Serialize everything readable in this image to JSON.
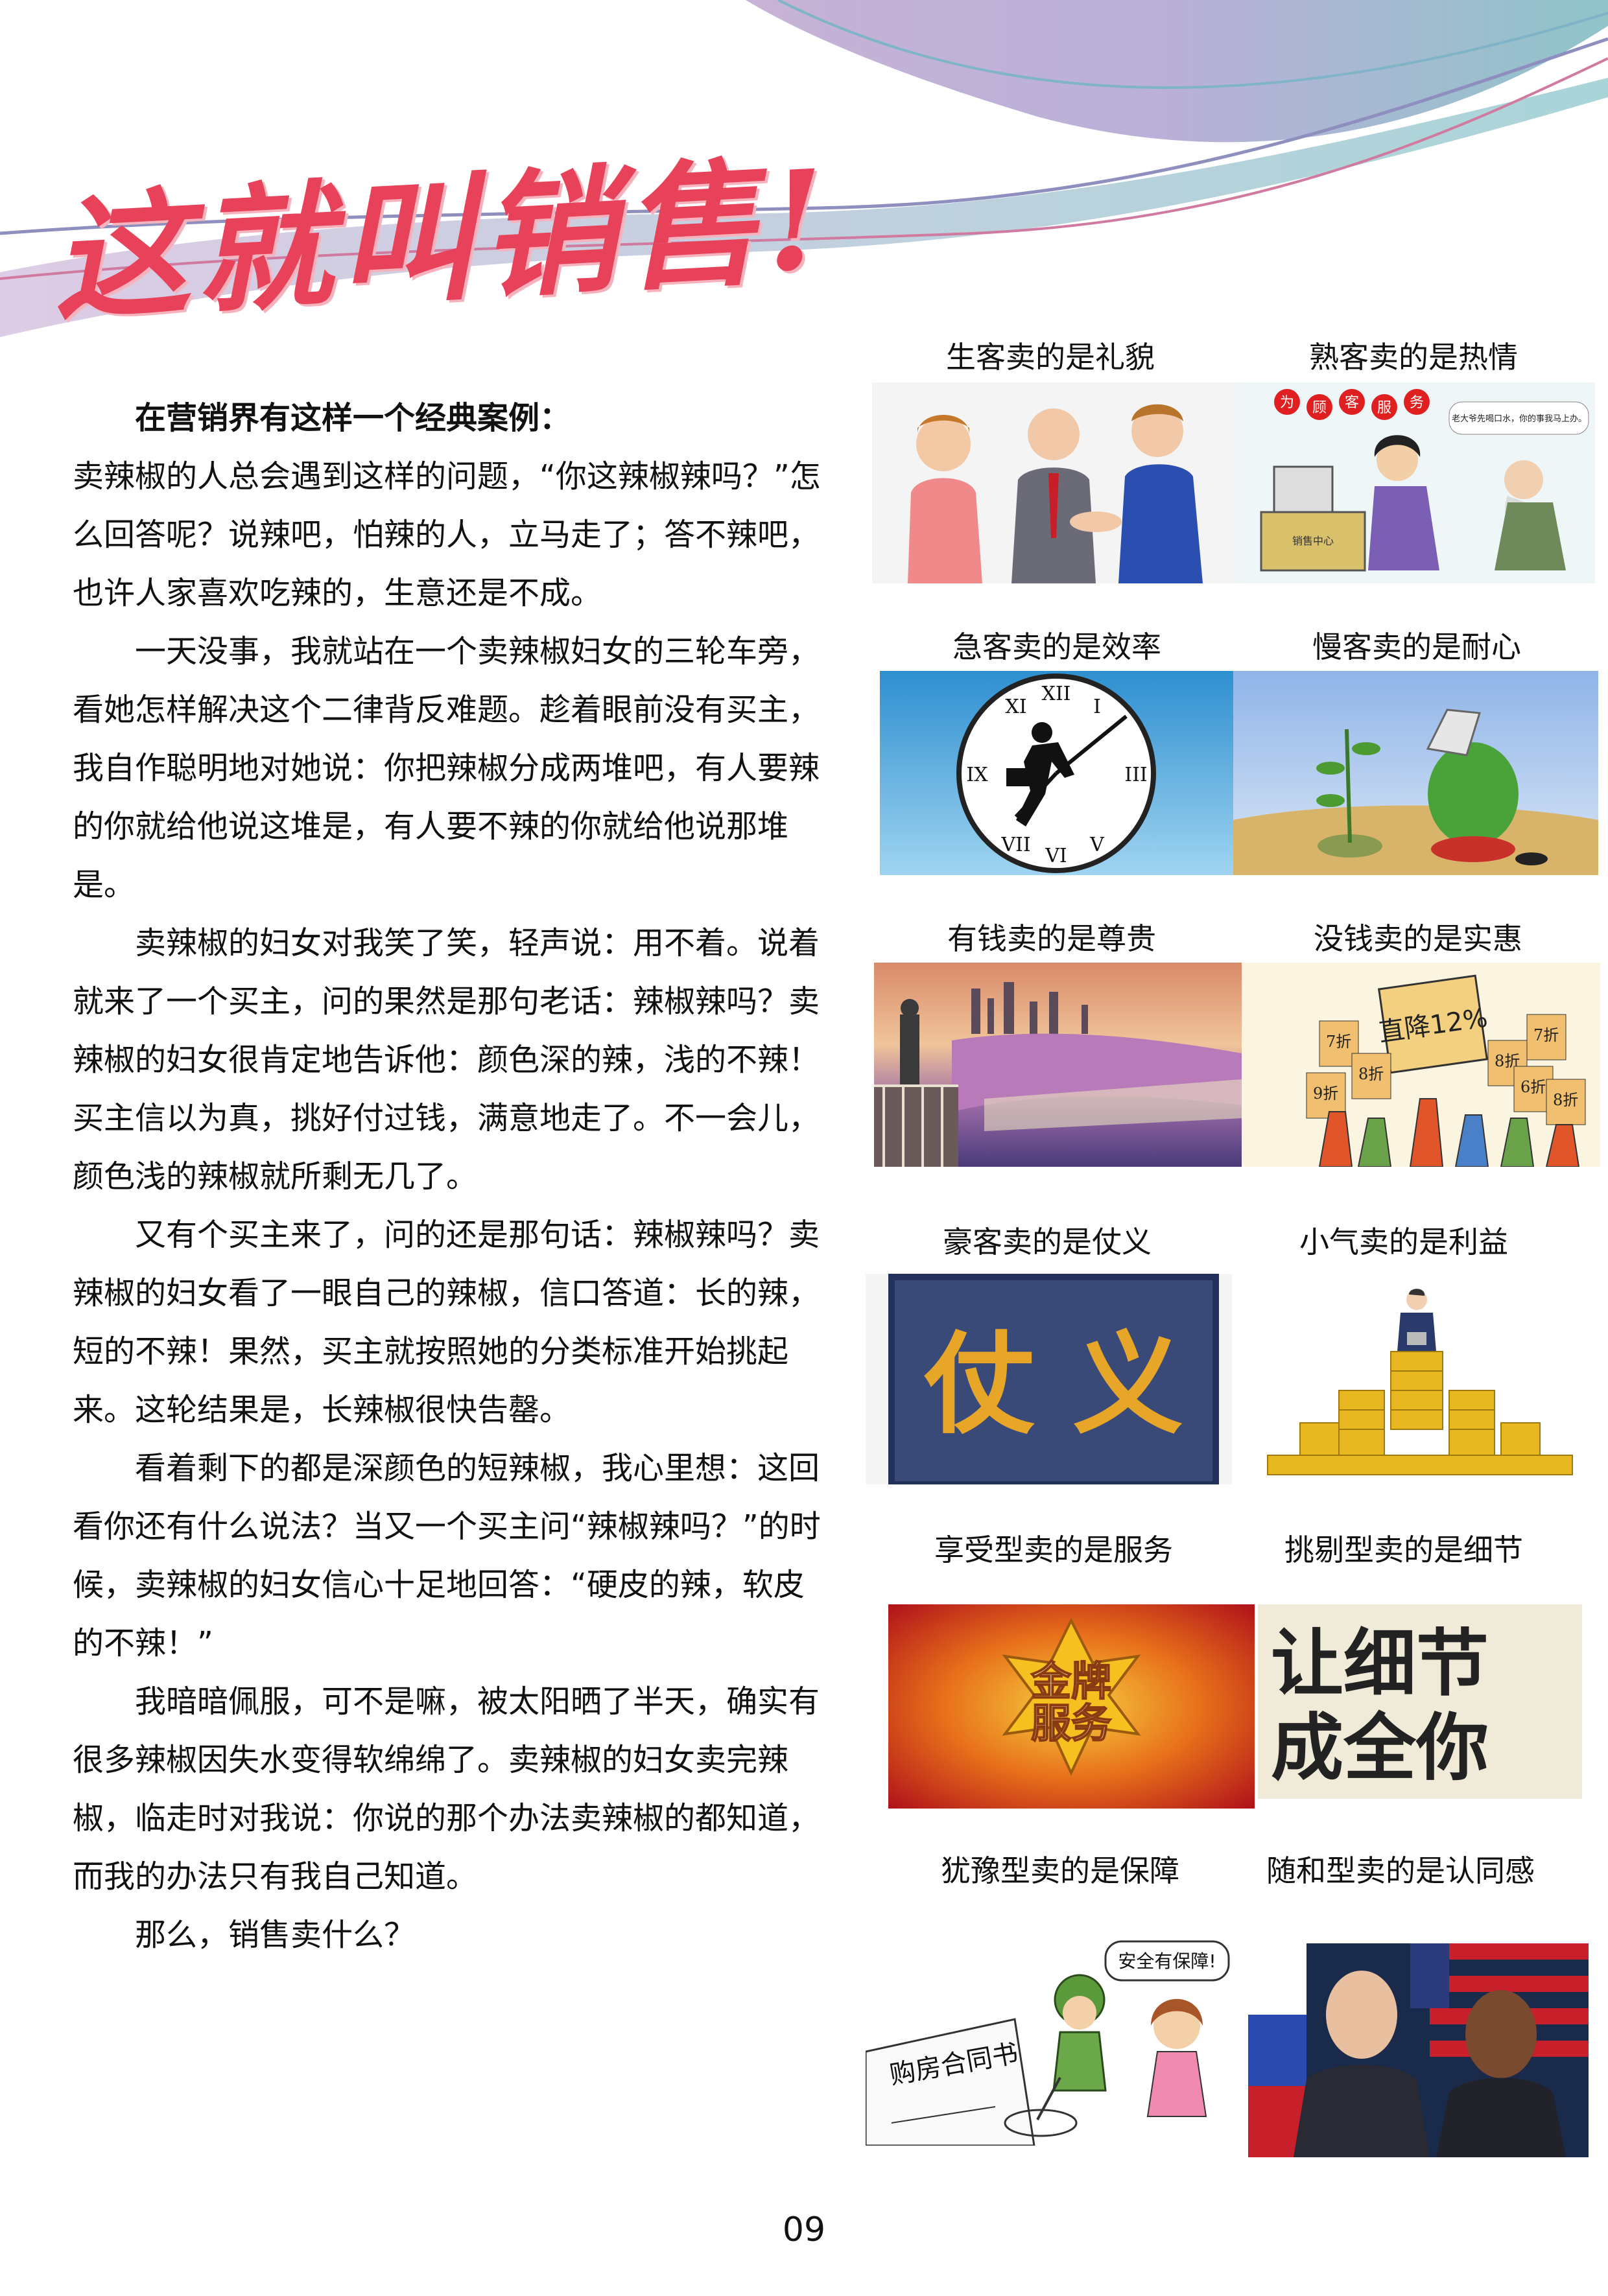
{
  "header": {
    "title": "这就叫销售!",
    "accent": "#e8415a"
  },
  "article": {
    "paragraphs": [
      "在营销界有这样一个经典案例：",
      "卖辣椒的人总会遇到这样的问题，“你这辣椒辣吗？”怎么回答呢？说辣吧，怕辣的人，立马走了；答不辣吧，也许人家喜欢吃辣的，生意还是不成。",
      "一天没事，我就站在一个卖辣椒妇女的三轮车旁，看她怎样解决这个二律背反难题。趁着眼前没有买主，我自作聪明地对她说：你把辣椒分成两堆吧，有人要辣的你就给他说这堆是，有人要不辣的你就给他说那堆是。",
      "卖辣椒的妇女对我笑了笑，轻声说：用不着。说着就来了一个买主，问的果然是那句老话：辣椒辣吗？卖辣椒的妇女很肯定地告诉他：颜色深的辣，浅的不辣！买主信以为真，挑好付过钱，满意地走了。不一会儿，颜色浅的辣椒就所剩无几了。",
      "又有个买主来了，问的还是那句话：辣椒辣吗？卖辣椒的妇女看了一眼自己的辣椒，信口答道：长的辣，短的不辣！果然，买主就按照她的分类标准开始挑起来。这轮结果是，长辣椒很快告罄。",
      "看着剩下的都是深颜色的短辣椒，我心里想：这回看你还有什么说法？当又一个买主问“辣椒辣吗？”的时候，卖辣椒的妇女信心十足地回答：“硬皮的辣，软皮的不辣！”",
      "我暗暗佩服，可不是嘛，被太阳晒了半天，确实有很多辣椒因失水变得软绵绵了。卖辣椒的妇女卖完辣椒，临走时对我说：你说的那个办法卖辣椒的都知道，而我的办法只有我自己知道。",
      "那么，销售卖什么？"
    ]
  },
  "captions": [
    "生客卖的是礼貌",
    "熟客卖的是热情",
    "急客卖的是效率",
    "慢客卖的是耐心",
    "有钱卖的是尊贵",
    "没钱卖的是实惠",
    "豪客卖的是仗义",
    "小气卖的是利益",
    "享受型卖的是服务",
    "挑剔型卖的是细节",
    "犹豫型卖的是保障",
    "随和型卖的是认同感"
  ],
  "image_text": {
    "service_banner": [
      "为",
      "顾",
      "客",
      "服",
      "务"
    ],
    "service_bubble": "老大爷先喝口水，你的事我马上办。",
    "service_desk": "销售中心",
    "discount_sign": "直降12%",
    "discount_tags": [
      "7折",
      "8折",
      "9折",
      "8折",
      "6折",
      "7折",
      "8折"
    ],
    "loyalty_words": "仗 义",
    "gold_badge": [
      "金牌",
      "服务"
    ],
    "detail_slogan": [
      "让细节",
      "成全你"
    ],
    "contract_title": "购房合同书",
    "safety_bubble": "安全有保障!"
  },
  "footer": {
    "page_number": "09"
  }
}
